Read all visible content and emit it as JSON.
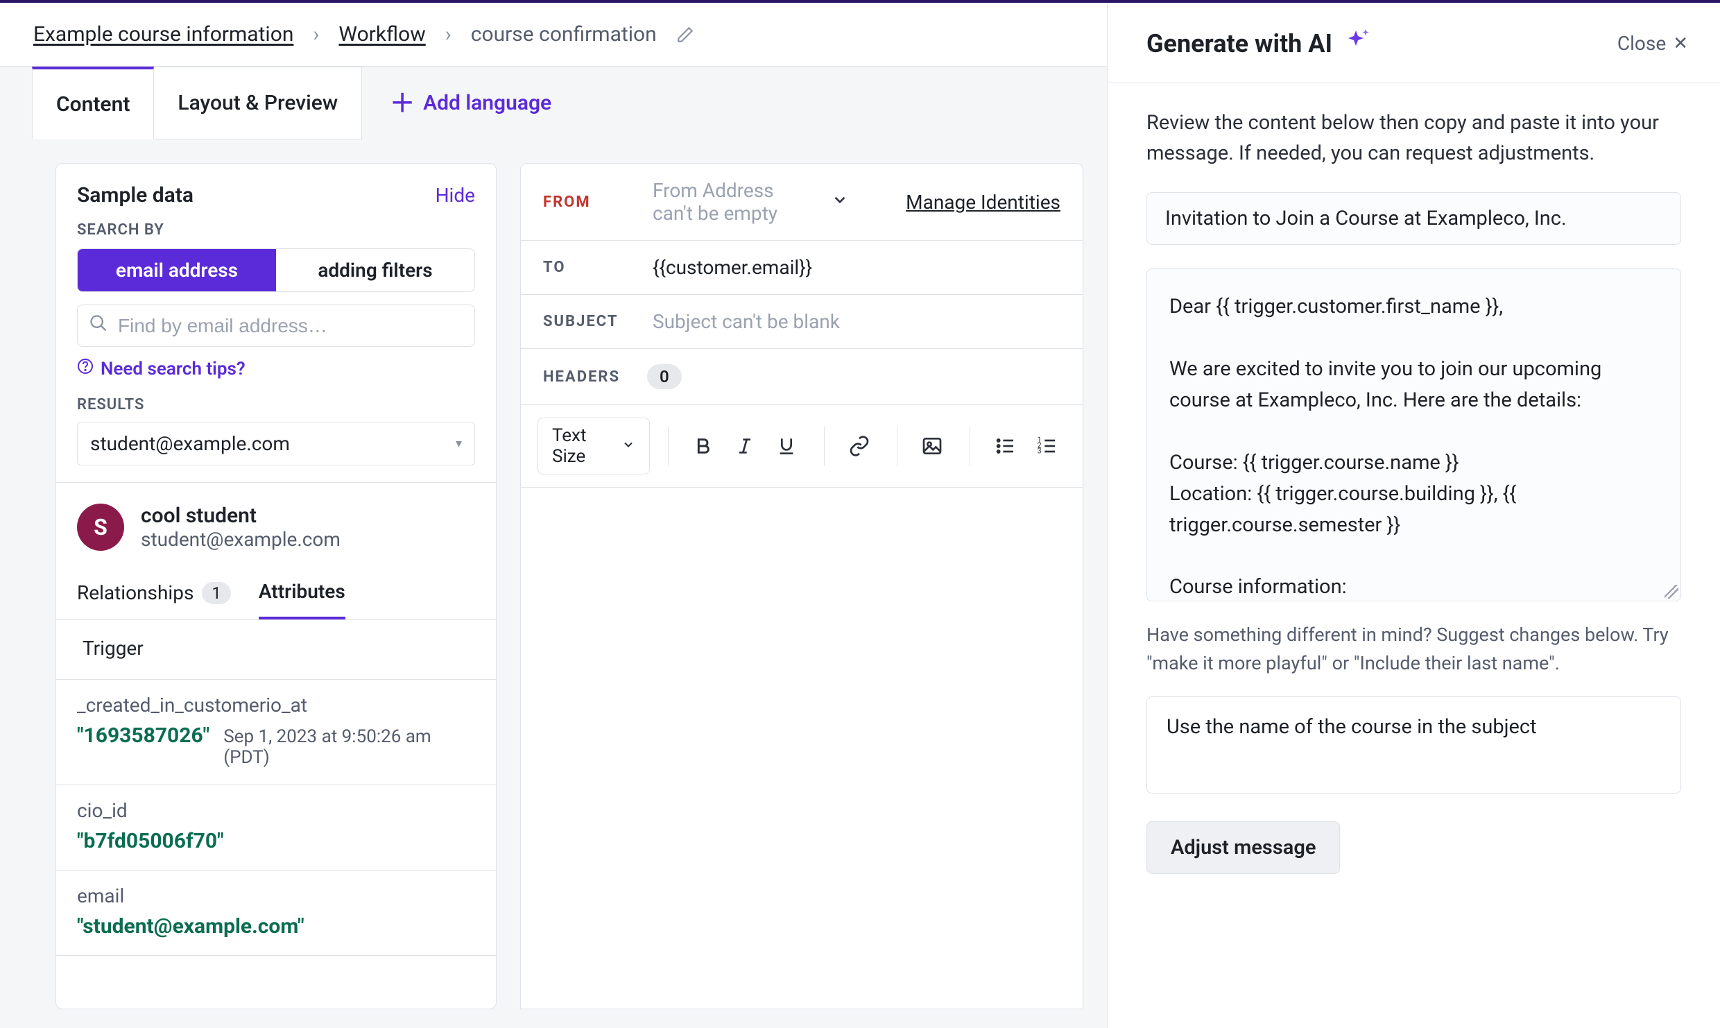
{
  "colors": {
    "brand": "#5B2BD9",
    "danger": "#C3352D",
    "json_green": "#0A6D51"
  },
  "breadcrumbs": {
    "root": "Example course information",
    "mid": "Workflow",
    "current": "course confirmation"
  },
  "tabs": {
    "content": "Content",
    "layout_preview": "Layout & Preview",
    "add_language": "Add language"
  },
  "sample": {
    "title": "Sample data",
    "hide": "Hide",
    "search_by_label": "SEARCH BY",
    "seg_email": "email address",
    "seg_filters": "adding filters",
    "search_placeholder": "Find by email address…",
    "tips": "Need search tips?",
    "results_label": "RESULTS",
    "selected_result": "student@example.com",
    "avatar_initial": "S",
    "person_name": "cool student",
    "person_email": "student@example.com",
    "subtabs": {
      "relationships": "Relationships",
      "relationships_count": "1",
      "attributes": "Attributes"
    },
    "trigger_label": "Trigger",
    "attributes": [
      {
        "key": "_created_in_customerio_at",
        "value": "\"1693587026\"",
        "meta": "Sep 1, 2023 at 9:50:26 am (PDT)"
      },
      {
        "key": "cio_id",
        "value": "\"b7fd05006f70\""
      },
      {
        "key": "email",
        "value": "\"student@example.com\""
      }
    ]
  },
  "editor": {
    "from_label": "FROM",
    "from_placeholder": "From Address can't be empty",
    "manage_identities": "Manage Identities",
    "to_label": "TO",
    "to_value": "{{customer.email}}",
    "subject_label": "SUBJECT",
    "subject_placeholder": "Subject can't be blank",
    "headers_label": "HEADERS",
    "headers_count": "0",
    "text_size": "Text Size",
    "toolbar_icons": {
      "bold": "bold-icon",
      "italic": "italic-icon",
      "underline": "underline-icon",
      "link": "link-icon",
      "image": "image-icon",
      "ul": "unordered-list-icon",
      "ol": "ordered-list-icon"
    }
  },
  "ai": {
    "title": "Generate with AI",
    "close": "Close",
    "intro": "Review the content below then copy and paste it into your message. If needed, you can request adjustments.",
    "subject_value": "Invitation to Join a Course at Exampleco, Inc.",
    "body_text": "Dear {{ trigger.customer.first_name }},\n\nWe are excited to invite you to join our upcoming course at Exampleco, Inc. Here are the details:\n\nCourse: {{ trigger.course.name }}\nLocation: {{ trigger.course.building }}, {{ trigger.course.semester }}\n\nCourse information:\n- Max number of students: {{",
    "hint": "Have something different in mind? Suggest changes below. Try \"make it more playful\" or \"Include their last name\".",
    "adjust_text": "Use the name of the course in the subject",
    "adjust_button": "Adjust message"
  }
}
